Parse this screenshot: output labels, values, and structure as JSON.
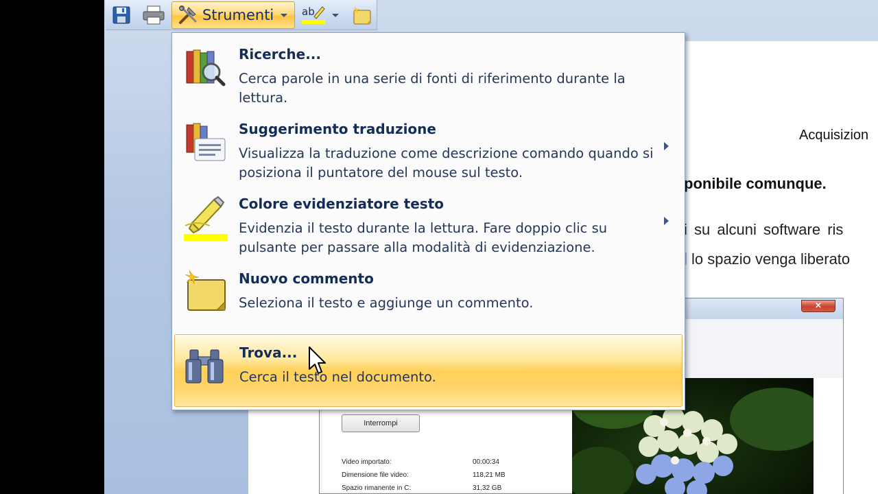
{
  "toolbar": {
    "tools_label": "Strumenti",
    "icons": [
      "save-icon",
      "print-icon",
      "tools-icon",
      "text-highlight-icon",
      "new-comment-icon"
    ]
  },
  "menu": {
    "items": [
      {
        "title": "Ricerche...",
        "description": "Cerca parole in una serie di fonti di riferimento durante la lettura.",
        "icon": "research-icon",
        "submenu": false
      },
      {
        "title": "Suggerimento traduzione",
        "description": "Visualizza la traduzione come descrizione comando quando si posiziona il puntatore del mouse sul testo.",
        "icon": "translation-icon",
        "submenu": true
      },
      {
        "title": "Colore evidenziatore testo",
        "description": "Evidenzia il testo durante la lettura. Fare doppio clic su pulsante per passare alla modalità di evidenziazione.",
        "icon": "highlighter-icon",
        "submenu": true
      },
      {
        "title": "Nuovo commento",
        "description": "Seleziona il testo e aggiunge un commento.",
        "icon": "comment-icon",
        "submenu": false
      },
      {
        "title": "Trova...",
        "description": "Cerca il testo nel documento.",
        "icon": "binoculars-icon",
        "submenu": false,
        "highlighted": true
      }
    ]
  },
  "document": {
    "heading_fragment": "Acquisizion",
    "bold_fragment": "ponibile comunque.",
    "line1_fragment": "i su alcuni software ris",
    "line2_fragment": "lo spazio venga liberato"
  },
  "embedded_window": {
    "close_label": "×",
    "stop_button": "Interrompi",
    "stats": [
      {
        "label": "Video importato:",
        "value": "00:00:34"
      },
      {
        "label": "Dimensione file video:",
        "value": "118,21 MB"
      },
      {
        "label": "Spazio rimanente in C:",
        "value": "31,32 GB"
      }
    ]
  },
  "colors": {
    "menu_highlight": "#ffd15a",
    "menu_title": "#132d57",
    "menu_description": "#25365a",
    "workspace": "#b4c8e3"
  }
}
